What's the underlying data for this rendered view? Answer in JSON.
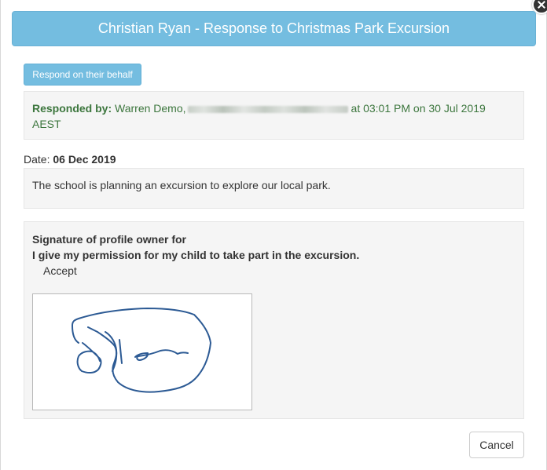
{
  "modal": {
    "title": "Christian Ryan - Response to Christmas Park Excursion"
  },
  "respond_button": {
    "label": "Respond on their behalf"
  },
  "responded": {
    "label": "Responded by:",
    "name": "Warren Demo,",
    "time_text": "at 03:01 PM on 30 Jul 2019",
    "timezone": "AEST"
  },
  "date": {
    "label": "Date:",
    "value": "06 Dec 2019"
  },
  "description": "The school is planning an excursion to explore our local park.",
  "signature_section": {
    "heading": "Signature of profile owner for",
    "permission": "I give my permission for my child to take part in the excursion.",
    "answer": "Accept",
    "stroke_color": "#2c5a94"
  },
  "cancel_button": {
    "label": "Cancel"
  },
  "colors": {
    "header_bg": "#74bde0",
    "responded_text": "#3c763d",
    "panel_bg": "#f5f5f5"
  }
}
